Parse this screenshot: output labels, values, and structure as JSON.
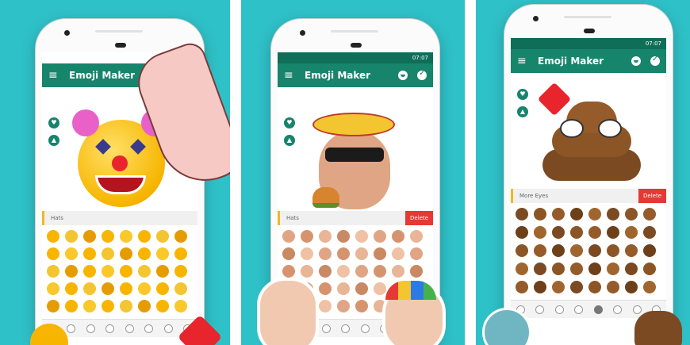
{
  "panels": [
    {
      "background": "#2fc1c8",
      "app_title": "Emoji Maker",
      "status_time": "",
      "category": "Hats",
      "delete_label": ""
    },
    {
      "background": "#2fc1c8",
      "app_title": "Emoji Maker",
      "status_time": "07:07",
      "category": "Hats",
      "delete_label": "Delete"
    },
    {
      "background": "#2fc1c8",
      "app_title": "Emoji Maker",
      "status_time": "07:07",
      "category": "More Eyes",
      "delete_label": "Delete"
    }
  ],
  "colors": {
    "appbar": "#17846c",
    "statusbar": "#0f6e58",
    "delete": "#e53935",
    "accent": "#f2b824",
    "emoji_yellow": "#f7b500",
    "poo_brown": "#7b4a22"
  },
  "icons": [
    "menu-icon",
    "hat-icon",
    "face-icon",
    "check-icon",
    "shield-icon",
    "bell-icon"
  ]
}
